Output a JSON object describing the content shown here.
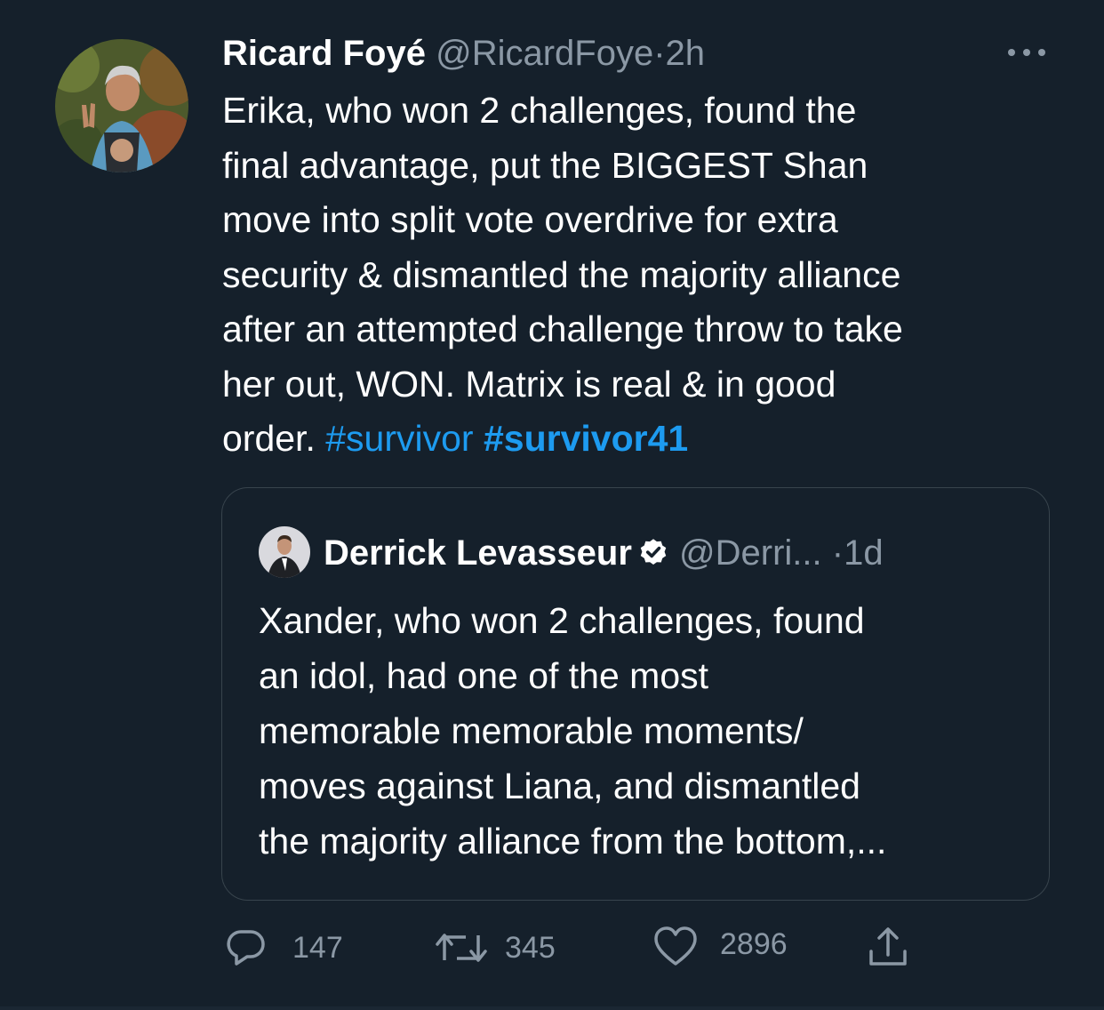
{
  "tweet": {
    "author_name": "Ricard Foyé",
    "author_handle": "@RicardFoye",
    "separator": "·",
    "time": "2h",
    "text_line_1": "Erika, who won 2 challenges, found the",
    "text_line_2": "final advantage, put the BIGGEST Shan",
    "text_line_3": "move into split vote overdrive for extra",
    "text_line_4": "security & dismantled the majority alliance",
    "text_line_5": "after an attempted challenge throw to take",
    "text_line_6": "her out, WON. Matrix is real & in good",
    "text_line_7_prefix": "order.",
    "hashtag_1": "#survivor",
    "hashtag_2": "#survivor41"
  },
  "quoted_tweet": {
    "author_name": "Derrick Levasseur",
    "author_handle": "@Derri...",
    "separator": "·",
    "time": "1d",
    "verified": true,
    "text_line_1": "Xander, who won 2 challenges, found",
    "text_line_2": "an idol, had one of the most",
    "text_line_3": "memorable memorable moments/",
    "text_line_4": "moves against Liana, and dismantled",
    "text_line_5": "the majority alliance from the bottom,..."
  },
  "actions": {
    "reply_count": "147",
    "retweet_count": "345",
    "like_count": "2896"
  },
  "icons": {
    "more": "more-horizontal-icon",
    "reply": "reply-icon",
    "retweet": "retweet-icon",
    "like": "heart-icon",
    "share": "share-icon",
    "verified": "verified-badge-icon"
  },
  "colors": {
    "background": "#15202b",
    "text": "#ffffff",
    "secondary": "#8b98a5",
    "link": "#1d9bf0",
    "border": "#38444d"
  }
}
